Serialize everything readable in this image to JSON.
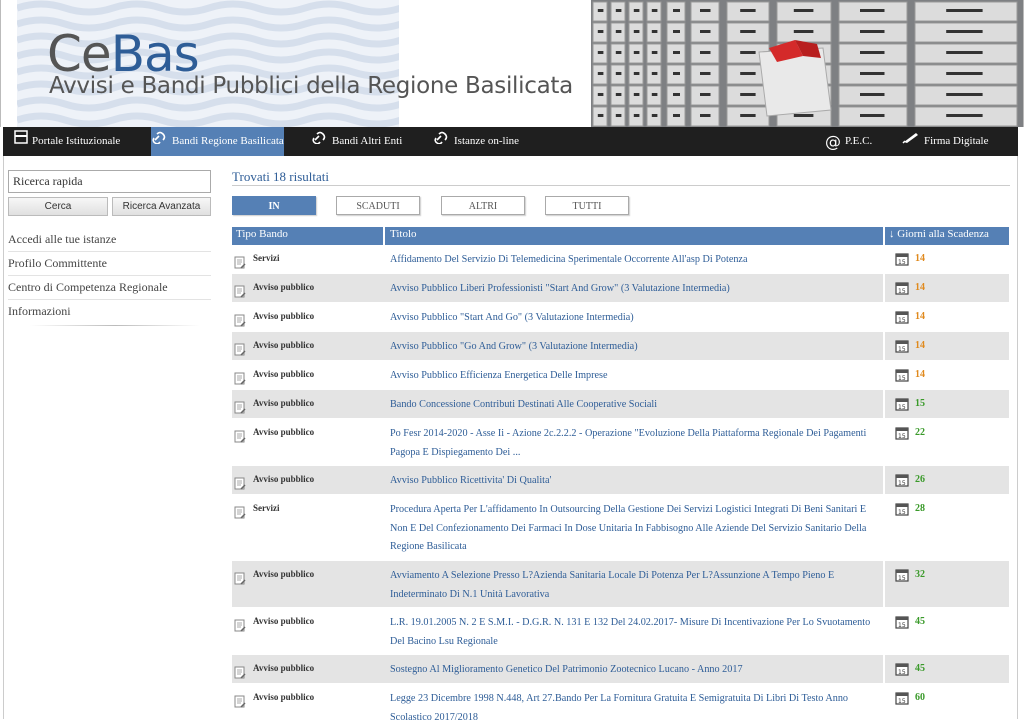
{
  "header": {
    "logo_ce": "Ce",
    "logo_bas": "Bas",
    "subtitle": "Avvisi e Bandi Pubblici della Regione Basilicata"
  },
  "nav": {
    "items": [
      {
        "label": "Portale Istituzionale",
        "icon": "portal-icon"
      },
      {
        "label": "Bandi Regione Basilicata",
        "icon": "link-icon",
        "active": true
      },
      {
        "label": "Bandi Altri Enti",
        "icon": "link-icon"
      },
      {
        "label": "Istanze on-line",
        "icon": "link-icon"
      }
    ],
    "right_items": [
      {
        "label": "P.E.C.",
        "icon": "at-icon"
      },
      {
        "label": "Firma Digitale",
        "icon": "pen-icon"
      }
    ]
  },
  "sidebar": {
    "search_value": "Ricerca rapida",
    "search_button": "Cerca",
    "advanced_button": "Ricerca Avanzata",
    "menu": [
      "Accedi alle tue istanze",
      "Profilo Committente",
      "Centro di Competenza Regionale",
      "Informazioni"
    ]
  },
  "results": {
    "count_text": "Trovati 18 risultati",
    "tabs": [
      "IN",
      "SCADUTI",
      "ALTRI",
      "TUTTI"
    ],
    "active_tab": "IN",
    "columns": [
      "Tipo Bando",
      "Titolo",
      "↓ Giorni alla Scadenza"
    ],
    "rows": [
      {
        "tipo": "Servizi",
        "titolo": "Affidamento Del Servizio Di Telemedicina Sperimentale Occorrente All'asp Di Potenza",
        "giorni": "14"
      },
      {
        "tipo": "Avviso pubblico",
        "titolo": "Avviso Pubblico Liberi Professionisti \"Start And Grow\" (3 Valutazione Intermedia)",
        "giorni": "14"
      },
      {
        "tipo": "Avviso pubblico",
        "titolo": "Avviso Pubblico \"Start And Go\" (3 Valutazione Intermedia)",
        "giorni": "14"
      },
      {
        "tipo": "Avviso pubblico",
        "titolo": "Avviso Pubblico \"Go And Grow\" (3 Valutazione Intermedia)",
        "giorni": "14"
      },
      {
        "tipo": "Avviso pubblico",
        "titolo": "Avviso Pubblico Efficienza Energetica Delle Imprese",
        "giorni": "14"
      },
      {
        "tipo": "Avviso pubblico",
        "titolo": "Bando Concessione Contributi Destinati Alle Cooperative Sociali",
        "giorni": "15"
      },
      {
        "tipo": "Avviso pubblico",
        "titolo": "Po Fesr 2014-2020 - Asse Ii - Azione 2c.2.2.2 - Operazione \"Evoluzione Della Piattaforma Regionale Dei Pagamenti Pagopa E Dispiegamento Dei ...",
        "giorni": "22"
      },
      {
        "tipo": "Avviso pubblico",
        "titolo": "Avviso Pubblico Ricettivita' Di Qualita'",
        "giorni": "26"
      },
      {
        "tipo": "Servizi",
        "titolo": "Procedura Aperta Per L'affidamento In Outsourcing Della Gestione Dei Servizi Logistici Integrati Di Beni Sanitari E Non E Del Confezionamento Dei Farmaci In Dose Unitaria In Fabbisogno Alle Aziende Del Servizio Sanitario Della Regione Basilicata",
        "giorni": "28"
      },
      {
        "tipo": "Avviso pubblico",
        "titolo": "Avviamento A Selezione Presso L?Azienda Sanitaria Locale Di Potenza Per L?Assunzione A Tempo Pieno E Indeterminato Di N.1 Unità Lavorativa",
        "giorni": "32"
      },
      {
        "tipo": "Avviso pubblico",
        "titolo": "L.R. 19.01.2005 N. 2 E S.M.I. - D.G.R. N. 131 E 132 Del 24.02.2017- Misure Di Incentivazione Per Lo Svuotamento Del Bacino Lsu Regionale",
        "giorni": "45"
      },
      {
        "tipo": "Avviso pubblico",
        "titolo": "Sostegno Al Miglioramento Genetico Del Patrimonio Zootecnico Lucano - Anno 2017",
        "giorni": "45"
      },
      {
        "tipo": "Avviso pubblico",
        "titolo": "Legge 23 Dicembre 1998 N.448, Art 27.Bando Per La Fornitura Gratuita E Semigratuita Di Libri Di Testo Anno Scolastico 2017/2018",
        "giorni": "60"
      }
    ]
  },
  "colors": {
    "accent": "#5580b5",
    "link": "#2e5d97",
    "days_orange": "#e08a1e",
    "days_green": "#3a9a2a",
    "nav_bg": "#1f1f1f"
  }
}
